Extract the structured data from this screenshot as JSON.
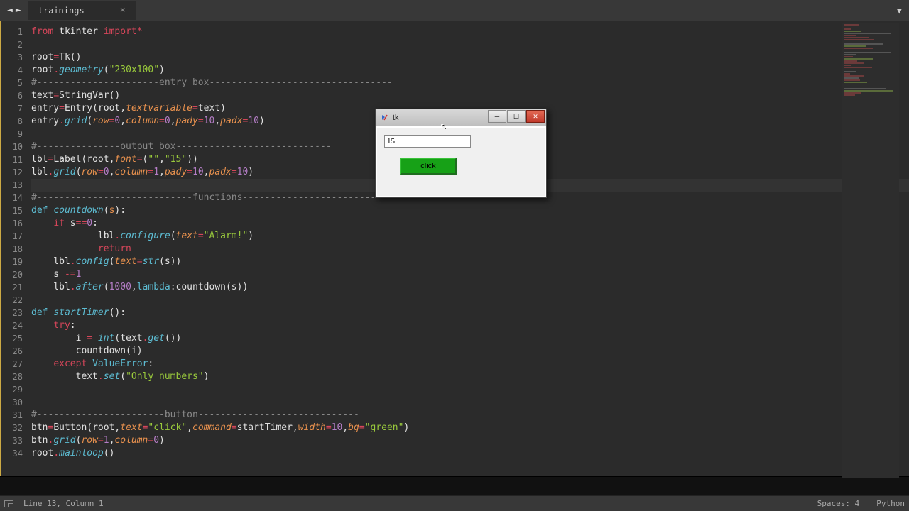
{
  "tab": {
    "name": "trainings"
  },
  "tk": {
    "title": "tk",
    "entry_value": "15",
    "button_label": "click"
  },
  "status": {
    "cursor": "Line 13, Column 1",
    "spaces": "Spaces: 4",
    "language": "Python"
  },
  "code_lines": [
    [
      [
        "kw-red",
        "from"
      ],
      [
        "txt",
        " tkinter "
      ],
      [
        "kw-red",
        "import"
      ],
      [
        "kw-red",
        "*"
      ]
    ],
    [],
    [
      [
        "txt",
        "root"
      ],
      [
        "kw-red",
        "="
      ],
      [
        "txt",
        "Tk()"
      ]
    ],
    [
      [
        "txt",
        "root"
      ],
      [
        "kw-red",
        "."
      ],
      [
        "fn",
        "geometry"
      ],
      [
        "txt",
        "("
      ],
      [
        "kw-green",
        "\"230x100\""
      ],
      [
        "txt",
        ")"
      ]
    ],
    [
      [
        "cmt",
        "#----------------------entry box---------------------------------"
      ]
    ],
    [
      [
        "txt",
        "text"
      ],
      [
        "kw-red",
        "="
      ],
      [
        "txt",
        "StringVar()"
      ]
    ],
    [
      [
        "txt",
        "entry"
      ],
      [
        "kw-red",
        "="
      ],
      [
        "txt",
        "Entry(root,"
      ],
      [
        "param-it",
        "textvariable"
      ],
      [
        "kw-red",
        "="
      ],
      [
        "txt",
        "text)"
      ]
    ],
    [
      [
        "txt",
        "entry"
      ],
      [
        "kw-red",
        "."
      ],
      [
        "fn",
        "grid"
      ],
      [
        "txt",
        "("
      ],
      [
        "param-it",
        "row"
      ],
      [
        "kw-red",
        "="
      ],
      [
        "kw-purple",
        "0"
      ],
      [
        "txt",
        ","
      ],
      [
        "param-it",
        "column"
      ],
      [
        "kw-red",
        "="
      ],
      [
        "kw-purple",
        "0"
      ],
      [
        "txt",
        ","
      ],
      [
        "param-it",
        "pady"
      ],
      [
        "kw-red",
        "="
      ],
      [
        "kw-purple",
        "10"
      ],
      [
        "txt",
        ","
      ],
      [
        "param-it",
        "padx"
      ],
      [
        "kw-red",
        "="
      ],
      [
        "kw-purple",
        "10"
      ],
      [
        "txt",
        ")"
      ]
    ],
    [],
    [
      [
        "cmt",
        "#---------------output box----------------------------"
      ]
    ],
    [
      [
        "txt",
        "lbl"
      ],
      [
        "kw-red",
        "="
      ],
      [
        "txt",
        "Label(root,"
      ],
      [
        "param-it",
        "font"
      ],
      [
        "kw-red",
        "="
      ],
      [
        "txt",
        "("
      ],
      [
        "kw-green",
        "\"\""
      ],
      [
        "txt",
        ","
      ],
      [
        "kw-green",
        "\"15\""
      ],
      [
        "txt",
        "))"
      ]
    ],
    [
      [
        "txt",
        "lbl"
      ],
      [
        "kw-red",
        "."
      ],
      [
        "fn",
        "grid"
      ],
      [
        "txt",
        "("
      ],
      [
        "param-it",
        "row"
      ],
      [
        "kw-red",
        "="
      ],
      [
        "kw-purple",
        "0"
      ],
      [
        "txt",
        ","
      ],
      [
        "param-it",
        "column"
      ],
      [
        "kw-red",
        "="
      ],
      [
        "kw-purple",
        "1"
      ],
      [
        "txt",
        ","
      ],
      [
        "param-it",
        "pady"
      ],
      [
        "kw-red",
        "="
      ],
      [
        "kw-purple",
        "10"
      ],
      [
        "txt",
        ","
      ],
      [
        "param-it",
        "padx"
      ],
      [
        "kw-red",
        "="
      ],
      [
        "kw-purple",
        "10"
      ],
      [
        "txt",
        ")"
      ]
    ],
    [],
    [
      [
        "cmt",
        "#----------------------------functions---------------------------"
      ]
    ],
    [
      [
        "kw-blue",
        "def"
      ],
      [
        "txt",
        " "
      ],
      [
        "fn",
        "countdown"
      ],
      [
        "txt",
        "("
      ],
      [
        "kw-orange",
        "s"
      ],
      [
        "txt",
        "):"
      ]
    ],
    [
      [
        "txt",
        "    "
      ],
      [
        "kw-red",
        "if"
      ],
      [
        "txt",
        " s"
      ],
      [
        "kw-red",
        "=="
      ],
      [
        "kw-purple",
        "0"
      ],
      [
        "txt",
        ":"
      ]
    ],
    [
      [
        "txt",
        "            lbl"
      ],
      [
        "kw-red",
        "."
      ],
      [
        "fn",
        "configure"
      ],
      [
        "txt",
        "("
      ],
      [
        "param-it",
        "text"
      ],
      [
        "kw-red",
        "="
      ],
      [
        "kw-green",
        "\"Alarm!\""
      ],
      [
        "txt",
        ")"
      ]
    ],
    [
      [
        "txt",
        "            "
      ],
      [
        "kw-red",
        "return"
      ]
    ],
    [
      [
        "txt",
        "    lbl"
      ],
      [
        "kw-red",
        "."
      ],
      [
        "fn",
        "config"
      ],
      [
        "txt",
        "("
      ],
      [
        "param-it",
        "text"
      ],
      [
        "kw-red",
        "="
      ],
      [
        "fn",
        "str"
      ],
      [
        "txt",
        "(s))"
      ]
    ],
    [
      [
        "txt",
        "    s "
      ],
      [
        "kw-red",
        "-="
      ],
      [
        "kw-purple",
        "1"
      ]
    ],
    [
      [
        "txt",
        "    lbl"
      ],
      [
        "kw-red",
        "."
      ],
      [
        "fn",
        "after"
      ],
      [
        "txt",
        "("
      ],
      [
        "kw-purple",
        "1000"
      ],
      [
        "txt",
        ","
      ],
      [
        "kw-blue",
        "lambda"
      ],
      [
        "txt",
        ":countdown(s))"
      ]
    ],
    [],
    [
      [
        "kw-blue",
        "def"
      ],
      [
        "txt",
        " "
      ],
      [
        "fn",
        "startTimer"
      ],
      [
        "txt",
        "():"
      ]
    ],
    [
      [
        "txt",
        "    "
      ],
      [
        "kw-red",
        "try"
      ],
      [
        "txt",
        ":"
      ]
    ],
    [
      [
        "txt",
        "        i "
      ],
      [
        "kw-red",
        "="
      ],
      [
        "txt",
        " "
      ],
      [
        "fn",
        "int"
      ],
      [
        "txt",
        "(text"
      ],
      [
        "kw-red",
        "."
      ],
      [
        "fn",
        "get"
      ],
      [
        "txt",
        "())"
      ]
    ],
    [
      [
        "txt",
        "        countdown(i)"
      ]
    ],
    [
      [
        "txt",
        "    "
      ],
      [
        "kw-red",
        "except"
      ],
      [
        "txt",
        " "
      ],
      [
        "kw-blue",
        "ValueError"
      ],
      [
        "txt",
        ":"
      ]
    ],
    [
      [
        "txt",
        "        text"
      ],
      [
        "kw-red",
        "."
      ],
      [
        "fn",
        "set"
      ],
      [
        "txt",
        "("
      ],
      [
        "kw-green",
        "\"Only numbers\""
      ],
      [
        "txt",
        ")"
      ]
    ],
    [],
    [],
    [
      [
        "cmt",
        "#-----------------------button-----------------------------"
      ]
    ],
    [
      [
        "txt",
        "btn"
      ],
      [
        "kw-red",
        "="
      ],
      [
        "txt",
        "Button(root,"
      ],
      [
        "param-it",
        "text"
      ],
      [
        "kw-red",
        "="
      ],
      [
        "kw-green",
        "\"click\""
      ],
      [
        "txt",
        ","
      ],
      [
        "param-it",
        "command"
      ],
      [
        "kw-red",
        "="
      ],
      [
        "txt",
        "startTimer,"
      ],
      [
        "param-it",
        "width"
      ],
      [
        "kw-red",
        "="
      ],
      [
        "kw-purple",
        "10"
      ],
      [
        "txt",
        ","
      ],
      [
        "param-it",
        "bg"
      ],
      [
        "kw-red",
        "="
      ],
      [
        "kw-green",
        "\"green\""
      ],
      [
        "txt",
        ")"
      ]
    ],
    [
      [
        "txt",
        "btn"
      ],
      [
        "kw-red",
        "."
      ],
      [
        "fn",
        "grid"
      ],
      [
        "txt",
        "("
      ],
      [
        "param-it",
        "row"
      ],
      [
        "kw-red",
        "="
      ],
      [
        "kw-purple",
        "1"
      ],
      [
        "txt",
        ","
      ],
      [
        "param-it",
        "column"
      ],
      [
        "kw-red",
        "="
      ],
      [
        "kw-purple",
        "0"
      ],
      [
        "txt",
        ")"
      ]
    ],
    [
      [
        "txt",
        "root"
      ],
      [
        "kw-red",
        "."
      ],
      [
        "fn",
        "mainloop"
      ],
      [
        "txt",
        "()"
      ]
    ]
  ]
}
